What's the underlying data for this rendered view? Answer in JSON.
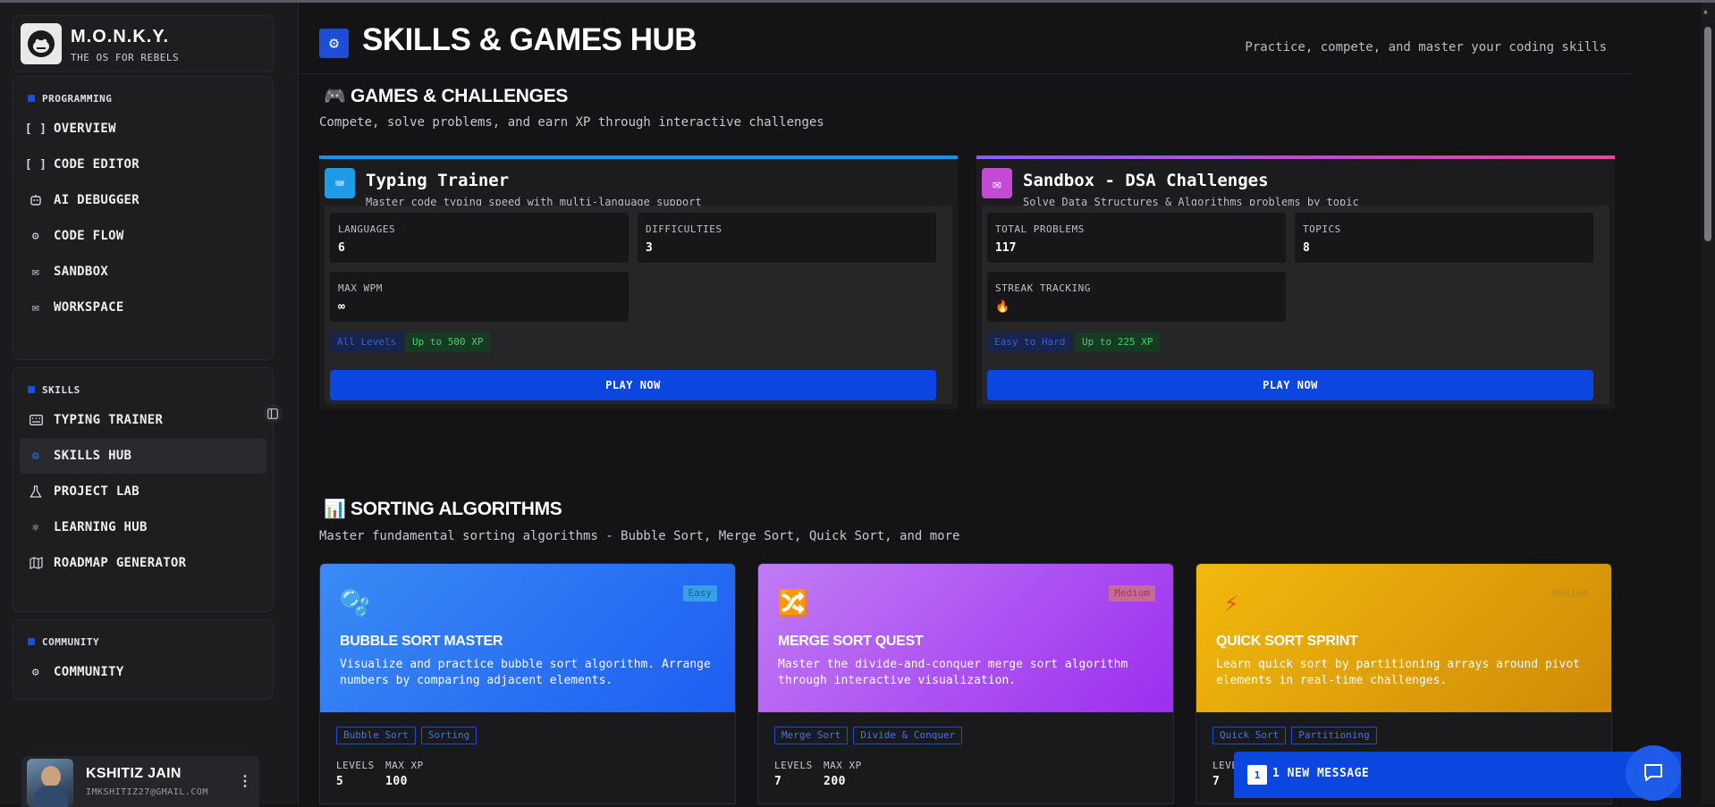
{
  "brand": {
    "title": "M.O.N.K.Y.",
    "subtitle": "THE OS FOR REBELS"
  },
  "sidebar": {
    "groups": [
      {
        "title": "PROGRAMMING",
        "items": [
          {
            "label": "OVERVIEW",
            "icon": "brackets-icon"
          },
          {
            "label": "CODE EDITOR",
            "icon": "brackets-icon"
          },
          {
            "label": "AI DEBUGGER",
            "icon": "bot-icon"
          },
          {
            "label": "CODE FLOW",
            "icon": "gear-icon"
          },
          {
            "label": "SANDBOX",
            "icon": "mail-icon"
          },
          {
            "label": "WORKSPACE",
            "icon": "mail-icon"
          }
        ]
      },
      {
        "title": "SKILLS",
        "items": [
          {
            "label": "TYPING TRAINER",
            "icon": "keyboard-icon"
          },
          {
            "label": "SKILLS HUB",
            "icon": "gear-icon",
            "active": true
          },
          {
            "label": "PROJECT LAB",
            "icon": "flask-icon"
          },
          {
            "label": "LEARNING HUB",
            "icon": "atom-icon"
          },
          {
            "label": "ROADMAP GENERATOR",
            "icon": "map-icon"
          }
        ]
      },
      {
        "title": "COMMUNITY",
        "items": [
          {
            "label": "COMMUNITY",
            "icon": "gear-icon"
          }
        ]
      }
    ]
  },
  "user": {
    "name": "KSHITIZ JAIN",
    "email": "IMKSHITIZ27@GMAIL.COM"
  },
  "header": {
    "title": "SKILLS & GAMES HUB",
    "subtitle": "Practice, compete, and master your coding skills"
  },
  "games_section": {
    "emoji": "🎮",
    "title": "GAMES & CHALLENGES",
    "subtitle": "Compete, solve problems, and earn XP through interactive challenges",
    "cards": [
      {
        "title": "Typing Trainer",
        "desc": "Master code typing speed with multi-language support",
        "bar_color": "#1d8fe0",
        "icon_color": "#1e9be6",
        "stats": [
          {
            "label": "LANGUAGES",
            "value": "6"
          },
          {
            "label": "DIFFICULTIES",
            "value": "3"
          },
          {
            "label": "MAX WPM",
            "value": "∞"
          }
        ],
        "chips": [
          "All Levels",
          "Up to 500 XP"
        ],
        "button": "PLAY NOW"
      },
      {
        "title": "Sandbox - DSA Challenges",
        "desc": "Solve Data Structures & Algorithms problems by topic",
        "bar_color": "#c84fd8",
        "icon_color": "#c44ad6",
        "stats": [
          {
            "label": "TOTAL PROBLEMS",
            "value": "117"
          },
          {
            "label": "TOPICS",
            "value": "8"
          },
          {
            "label": "STREAK TRACKING",
            "value": "🔥"
          }
        ],
        "chips": [
          "Easy to Hard",
          "Up to 225 XP"
        ],
        "button": "PLAY NOW"
      }
    ]
  },
  "sorting_section": {
    "emoji": "📊",
    "title": "SORTING ALGORITHMS",
    "subtitle": "Master fundamental sorting algorithms - Bubble Sort, Merge Sort, Quick Sort, and more",
    "cards": [
      {
        "title": "BUBBLE SORT MASTER",
        "desc": "Visualize and practice bubble sort algorithm. Arrange numbers by comparing adjacent elements.",
        "badge": "Easy",
        "icon": "🫧",
        "tags": [
          "Bubble Sort",
          "Sorting"
        ],
        "levels_label": "LEVELS",
        "levels": "5",
        "xp_label": "MAX XP",
        "xp": "100"
      },
      {
        "title": "MERGE SORT QUEST",
        "desc": "Master the divide-and-conquer merge sort algorithm through interactive visualization.",
        "badge": "Medium",
        "icon": "🔀",
        "tags": [
          "Merge Sort",
          "Divide & Conquer"
        ],
        "levels_label": "LEVELS",
        "levels": "7",
        "xp_label": "MAX XP",
        "xp": "200"
      },
      {
        "title": "QUICK SORT SPRINT",
        "desc": "Learn quick sort by partitioning arrays around pivot elements in real-time challenges.",
        "badge": "Medium",
        "icon": "⚡",
        "tags": [
          "Quick Sort",
          "Partitioning"
        ],
        "levels_label": "LEVELS",
        "levels": "7"
      }
    ]
  },
  "messages": {
    "count": "1",
    "label": "1 NEW MESSAGE"
  },
  "colors": {
    "accent": "#0b46e0",
    "background": "#141416",
    "sidebar": "#1b1b1e"
  }
}
